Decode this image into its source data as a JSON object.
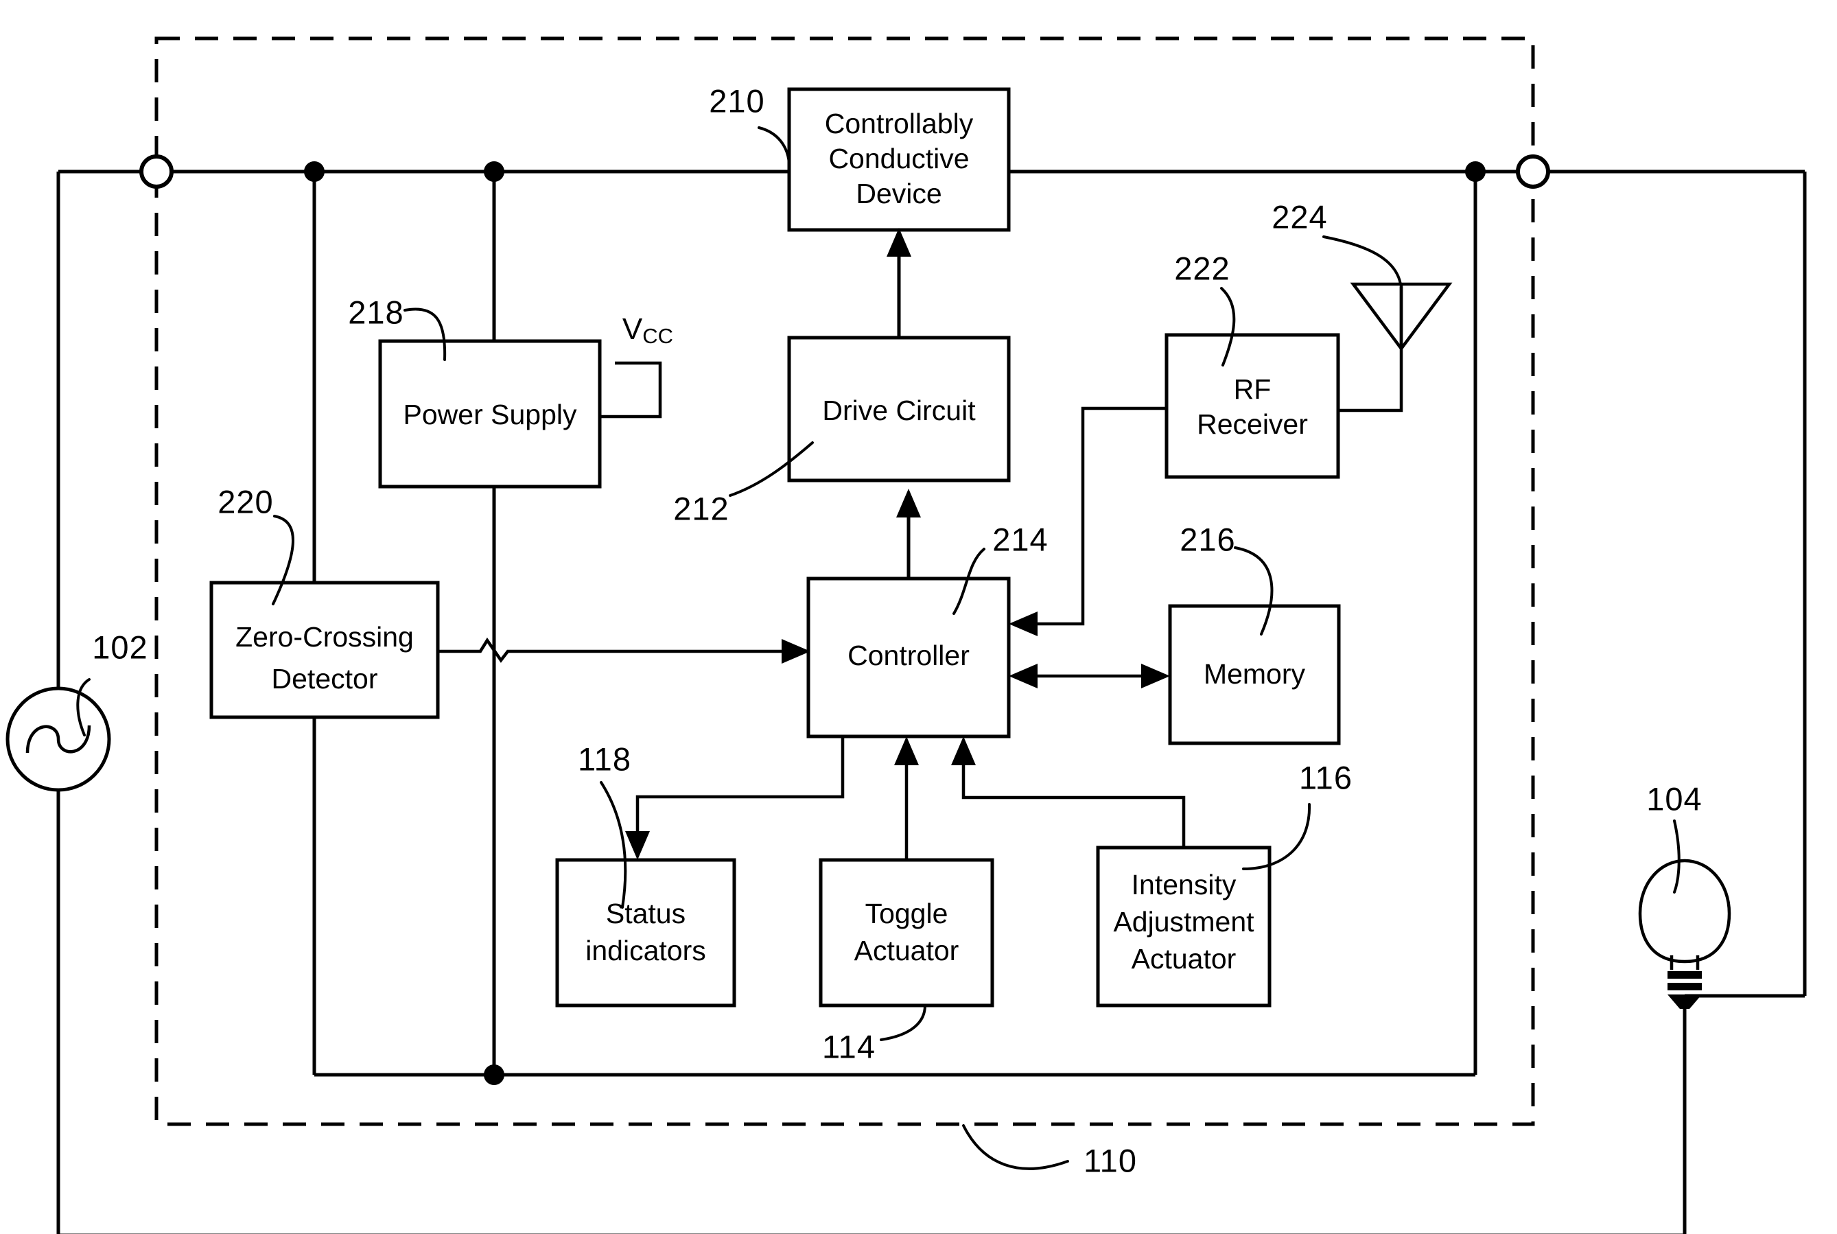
{
  "figure": {
    "title": "Dimmer switch block diagram",
    "type": "patent-block-diagram",
    "stroke_color": "#000000",
    "background_color": "#ffffff"
  },
  "blocks": [
    {
      "id": "ccd",
      "label": "Controllably\nConductive Device",
      "line1": "Controllably",
      "line2": "Conductive",
      "line3": "Device",
      "ref": "210"
    },
    {
      "id": "psu",
      "label": "Power Supply",
      "line1": "Power Supply",
      "ref": "218"
    },
    {
      "id": "drive",
      "label": "Drive Circuit",
      "line1": "Drive Circuit",
      "ref": "212"
    },
    {
      "id": "rf",
      "label": "RF Receiver",
      "line1": "RF",
      "line2": "Receiver",
      "ref": "222"
    },
    {
      "id": "zcd",
      "label": "Zero-Crossing Detector",
      "line1": "Zero-Crossing",
      "line2": "Detector",
      "ref": "220"
    },
    {
      "id": "ctrl",
      "label": "Controller",
      "line1": "Controller",
      "ref": "214"
    },
    {
      "id": "mem",
      "label": "Memory",
      "line1": "Memory",
      "ref": "216"
    },
    {
      "id": "status",
      "label": "Status indicators",
      "line1": "Status",
      "line2": "indicators",
      "ref": "118"
    },
    {
      "id": "toggle",
      "label": "Toggle Actuator",
      "line1": "Toggle",
      "line2": "Actuator",
      "ref": "114"
    },
    {
      "id": "intensity",
      "label": "Intensity Adjustment Actuator",
      "line1": "Intensity",
      "line2": "Adjustment",
      "line3": "Actuator",
      "ref": "116"
    }
  ],
  "symbols": [
    {
      "id": "ac-source",
      "name": "ac-voltage-source",
      "ref": "102"
    },
    {
      "id": "lamp",
      "name": "lamp-load",
      "ref": "104"
    },
    {
      "id": "antenna",
      "name": "antenna",
      "ref": "224"
    },
    {
      "id": "enclosure",
      "name": "dimmer-enclosure-boundary",
      "ref": "110"
    }
  ],
  "ref_numbers": {
    "ac_source": "102",
    "lamp": "104",
    "toggle_actuator": "114",
    "intensity_actuator": "116",
    "status_indicators": "118",
    "enclosure": "110",
    "controllably_conductive_device": "210",
    "drive_circuit": "212",
    "controller": "214",
    "memory": "216",
    "power_supply": "218",
    "zero_crossing_detector": "220",
    "rf_receiver": "222",
    "antenna": "224"
  },
  "labels": {
    "vcc_main": "V",
    "vcc_sub": "CC"
  }
}
